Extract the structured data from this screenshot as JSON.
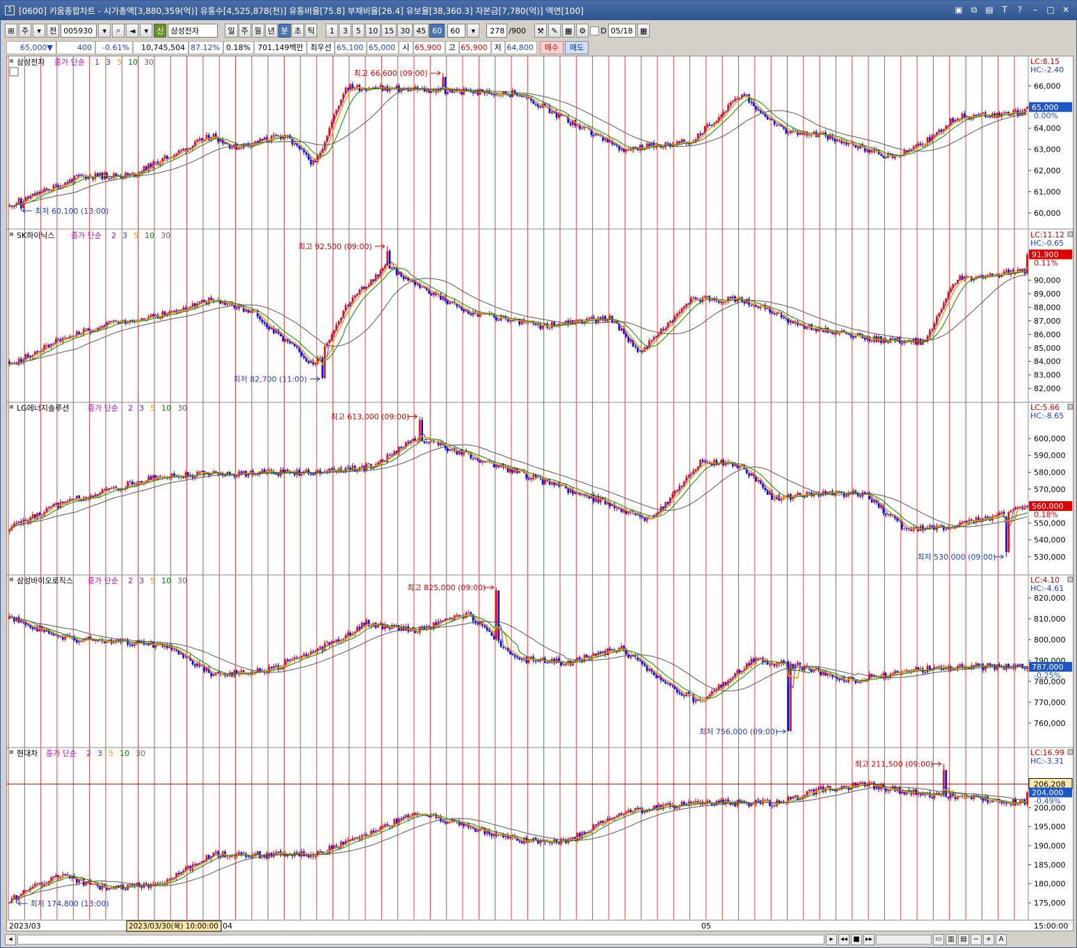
{
  "window": {
    "title": "[0600] 키움종합차트 - 시가총액[3,880,359(억)] 유통수[4,525,878(천)] 유통비율[75.8] 부채비율[26.4] 유보율[38,360.3] 자본금[7,780(억)] 액면[100]",
    "badge": "1"
  },
  "toolbar": {
    "period_menu": "주",
    "prev": "전",
    "code": "005930",
    "stock_badge": "신",
    "stock_name": "삼성전자",
    "periods": [
      "일",
      "주",
      "월",
      "년",
      "분",
      "초",
      "틱"
    ],
    "active_period": "분",
    "intervals": [
      "1",
      "3",
      "5",
      "10",
      "15",
      "30",
      "45",
      "60"
    ],
    "active_interval": "60",
    "interval_value": "60",
    "count": "278",
    "count_max": "/900",
    "d_label": "D",
    "date": "05/18"
  },
  "quote": {
    "price": "65,000",
    "change": "400",
    "change_pct": "-0.61%",
    "volume": "10,745,504",
    "vol_ratio": "87.12%",
    "turnover": "0.18%",
    "amount": "701,149백만",
    "best_ask_label": "최우선",
    "best_ask": "65,100",
    "best_bid": "65,000",
    "open_label": "시",
    "open": "65,900",
    "high_label": "고",
    "high": "65,900",
    "low_label": "저",
    "low": "64,800",
    "buy": "매수",
    "sell": "매도"
  },
  "panes": [
    {
      "name": "삼성전자",
      "indicator": "종가 단순",
      "periods": [
        "1",
        "3",
        "5",
        "10",
        "30"
      ],
      "lc": "LC:8.15",
      "hc": "HC:-2.40",
      "price_tag": "65,000",
      "pct": "0.00%",
      "yticks": [
        "66,000",
        "65,000",
        "64,000",
        "63,000",
        "62,000",
        "61,000",
        "60,000"
      ],
      "ymin": 59700,
      "ymax": 66800,
      "high_label": "최고 66,600 (09:00)",
      "low_label": "최저 60,100 (13:00)",
      "start": 60300,
      "end": 65000,
      "hi": 66600,
      "lo": 60100,
      "hiIdx": 187,
      "loIdx": 5,
      "seed": 11,
      "shape": [
        [
          0,
          0.04
        ],
        [
          0.07,
          0.25
        ],
        [
          0.12,
          0.26
        ],
        [
          0.2,
          0.55
        ],
        [
          0.22,
          0.46
        ],
        [
          0.27,
          0.55
        ],
        [
          0.3,
          0.33
        ],
        [
          0.33,
          0.9
        ],
        [
          0.5,
          0.85
        ],
        [
          0.6,
          0.45
        ],
        [
          0.67,
          0.5
        ],
        [
          0.72,
          0.85
        ],
        [
          0.76,
          0.58
        ],
        [
          0.8,
          0.55
        ],
        [
          0.87,
          0.38
        ],
        [
          0.9,
          0.5
        ],
        [
          0.93,
          0.68
        ],
        [
          1,
          0.72
        ]
      ]
    },
    {
      "name": "SK하이닉스",
      "indicator": "종가 단순",
      "periods": [
        "2",
        "3",
        "5",
        "10",
        "30"
      ],
      "lc": "LC:11.12",
      "hc": "HC:-0.65",
      "price_tag": "91,900",
      "pct": "0.11%",
      "yticks": [
        "90,000",
        "89,000",
        "88,000",
        "87,000",
        "86,000",
        "85,000",
        "84,000",
        "83,000",
        "82,000"
      ],
      "ymin": 81700,
      "ymax": 92800,
      "high_label": "최고 92,500 (09:00)",
      "low_label": "최저 82,700 (11:00)",
      "start": 84000,
      "end": 91900,
      "hi": 92500,
      "lo": 82700,
      "hiIdx": 163,
      "loIdx": 135,
      "seed": 23,
      "shape": [
        [
          0,
          0.1
        ],
        [
          0.05,
          0.3
        ],
        [
          0.1,
          0.42
        ],
        [
          0.16,
          0.5
        ],
        [
          0.2,
          0.6
        ],
        [
          0.24,
          0.5
        ],
        [
          0.3,
          0.1
        ],
        [
          0.33,
          0.55
        ],
        [
          0.37,
          0.85
        ],
        [
          0.45,
          0.5
        ],
        [
          0.52,
          0.4
        ],
        [
          0.59,
          0.46
        ],
        [
          0.62,
          0.2
        ],
        [
          0.67,
          0.6
        ],
        [
          0.72,
          0.6
        ],
        [
          0.78,
          0.4
        ],
        [
          0.85,
          0.3
        ],
        [
          0.9,
          0.28
        ],
        [
          0.93,
          0.75
        ],
        [
          1,
          0.82
        ]
      ]
    },
    {
      "name": "LG에너지솔루션",
      "indicator": "종가 단순",
      "periods": [
        "2",
        "3",
        "5",
        "10",
        "30"
      ],
      "lc": "LC:5.66",
      "hc": "HC:-8.65",
      "price_tag": "560,000",
      "pct": "0.18%",
      "yticks": [
        "600,000",
        "590,000",
        "580,000",
        "570,000",
        "560,000",
        "550,000",
        "540,000",
        "530,000"
      ],
      "ymin": 525000,
      "ymax": 614000,
      "high_label": "최고 613,000 (09:00)",
      "low_label": "최저 530,000 (09:00)",
      "start": 545000,
      "end": 560000,
      "hi": 613000,
      "lo": 530000,
      "hiIdx": 177,
      "loIdx": 430,
      "seed": 37,
      "shape": [
        [
          0,
          0.2
        ],
        [
          0.05,
          0.38
        ],
        [
          0.15,
          0.58
        ],
        [
          0.25,
          0.6
        ],
        [
          0.3,
          0.6
        ],
        [
          0.36,
          0.65
        ],
        [
          0.4,
          0.85
        ],
        [
          0.5,
          0.6
        ],
        [
          0.58,
          0.4
        ],
        [
          0.63,
          0.25
        ],
        [
          0.68,
          0.68
        ],
        [
          0.72,
          0.65
        ],
        [
          0.75,
          0.42
        ],
        [
          0.8,
          0.45
        ],
        [
          0.84,
          0.45
        ],
        [
          0.88,
          0.2
        ],
        [
          0.92,
          0.2
        ],
        [
          1,
          0.35
        ]
      ]
    },
    {
      "name": "삼성바이오로직스",
      "indicator": "종가 단순",
      "periods": [
        "2",
        "3",
        "5",
        "10",
        "30"
      ],
      "lc": "LC:4.10",
      "hc": "HC:-4.61",
      "price_tag": "787,000",
      "pct": "-0.25%",
      "yticks": [
        "820,000",
        "810,000",
        "800,000",
        "790,000",
        "780,000",
        "770,000",
        "760,000"
      ],
      "ymin": 753000,
      "ymax": 825000,
      "high_label": "최고 825,000 (09:00)",
      "low_label": "최저 756,000 (09:00)",
      "start": 810000,
      "end": 787000,
      "hi": 825000,
      "lo": 756000,
      "hiIdx": 210,
      "loIdx": 336,
      "seed": 41,
      "shape": [
        [
          0,
          0.8
        ],
        [
          0.05,
          0.65
        ],
        [
          0.15,
          0.6
        ],
        [
          0.2,
          0.4
        ],
        [
          0.25,
          0.42
        ],
        [
          0.3,
          0.55
        ],
        [
          0.35,
          0.75
        ],
        [
          0.4,
          0.7
        ],
        [
          0.45,
          0.82
        ],
        [
          0.5,
          0.5
        ],
        [
          0.55,
          0.48
        ],
        [
          0.6,
          0.58
        ],
        [
          0.65,
          0.3
        ],
        [
          0.68,
          0.2
        ],
        [
          0.73,
          0.5
        ],
        [
          0.78,
          0.45
        ],
        [
          0.82,
          0.35
        ],
        [
          0.87,
          0.4
        ],
        [
          0.92,
          0.45
        ],
        [
          1,
          0.45
        ]
      ]
    },
    {
      "name": "현대차",
      "indicator": "종가 단순",
      "periods": [
        "2",
        "3",
        "5",
        "10",
        "30"
      ],
      "lc": "LC:16.99",
      "hc": "HC:-3.31",
      "price_tag": "204,000",
      "pct": "-0.49%",
      "crosshair_price": "206,208",
      "yticks": [
        "200,000",
        "195,000",
        "190,000",
        "185,000",
        "180,000",
        "175,000"
      ],
      "ymin": 173000,
      "ymax": 212500,
      "high_label": "최고 211,500 (09:00)",
      "low_label": "최저 174,800 (13:00)",
      "start": 175000,
      "end": 204000,
      "hi": 211500,
      "lo": 174800,
      "hiIdx": 403,
      "loIdx": 3,
      "seed": 53,
      "shape": [
        [
          0,
          0.05
        ],
        [
          0.05,
          0.2
        ],
        [
          0.1,
          0.1
        ],
        [
          0.15,
          0.15
        ],
        [
          0.2,
          0.35
        ],
        [
          0.3,
          0.35
        ],
        [
          0.35,
          0.5
        ],
        [
          0.4,
          0.65
        ],
        [
          0.45,
          0.55
        ],
        [
          0.5,
          0.45
        ],
        [
          0.55,
          0.45
        ],
        [
          0.6,
          0.65
        ],
        [
          0.67,
          0.72
        ],
        [
          0.75,
          0.72
        ],
        [
          0.8,
          0.82
        ],
        [
          0.84,
          0.85
        ],
        [
          0.9,
          0.78
        ],
        [
          1,
          0.72
        ]
      ]
    }
  ],
  "xaxis": {
    "labels": [
      "2023/03",
      "04",
      "05"
    ],
    "cursor_label": "2023/03/30(목) 10:00:00",
    "right_label": "15:00:00"
  },
  "colors": {
    "up": "#ff0000",
    "down": "#0000ff",
    "ma2": "#cc00cc",
    "ma3": "#3333ff",
    "ma5": "#ff9900",
    "ma10": "#008800",
    "ma30": "#555555",
    "session": "#e34040",
    "accent": "#2255c0"
  }
}
